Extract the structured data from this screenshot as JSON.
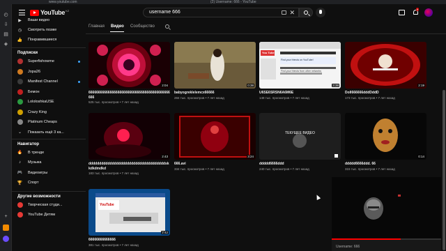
{
  "browser": {
    "address": "www.youtube.com",
    "window_title": "(2) Username: 666 - YouTube"
  },
  "topbar": {
    "logo_text": "YouTube",
    "logo_country": "KZ",
    "search_value": "username 666",
    "notifications_count": "9"
  },
  "sidebar": {
    "top_items": [
      {
        "label": "Ваши видео",
        "icon": "play-icon"
      },
      {
        "label": "Смотреть позже",
        "icon": "clock-icon"
      },
      {
        "label": "Понравившиеся",
        "icon": "thumbs-up-icon"
      }
    ],
    "subscriptions_heading": "Подписки",
    "subscriptions": [
      {
        "label": "Superfishowme",
        "color": "#b03030",
        "live": true
      },
      {
        "label": "Jopa26",
        "color": "#d07a20",
        "live": false
      },
      {
        "label": "Manifest Channel",
        "color": "#3a3a3a",
        "live": true
      },
      {
        "label": "Бемон",
        "color": "#c02020",
        "live": false
      },
      {
        "label": "LololoshkaUSE",
        "color": "#2a9a40",
        "live": false
      },
      {
        "label": "Crazy King",
        "color": "#d0a000",
        "live": false
      },
      {
        "label": "Platinum Cheaps",
        "color": "#888888",
        "live": false
      }
    ],
    "show_more": "Показать ещё 3 ка...",
    "navigator_heading": "Навигатор",
    "navigator": [
      {
        "label": "В тренде",
        "icon": "fire-icon"
      },
      {
        "label": "Музыка",
        "icon": "music-icon"
      },
      {
        "label": "Видеоигры",
        "icon": "gamepad-icon"
      },
      {
        "label": "Спорт",
        "icon": "trophy-icon"
      }
    ],
    "more_heading": "Другие возможности",
    "more": [
      {
        "label": "Творческая студи...",
        "color": "#e53935"
      },
      {
        "label": "YouTube Детям",
        "color": "#e53935"
      }
    ]
  },
  "tabs": [
    "Главная",
    "Видео",
    "Сообщество"
  ],
  "active_tab": "Видео",
  "videos": [
    {
      "title": "666666666666666666666666666666666666666666666",
      "duration": "2:04",
      "views": "525 тыс. просмотров",
      "age": "7 лет назад",
      "theme": "kaleido"
    },
    {
      "title": "babyogreklelemcx66666",
      "duration": "0:38",
      "views": "284 тыс. просмотров",
      "age": "7 лет назад",
      "theme": "woman"
    },
    {
      "title": "U6SE6SRSN6A6M6E",
      "duration": "3:38",
      "views": "148 тыс. просмотров",
      "age": "7 лет назад",
      "theme": "webpage"
    },
    {
      "title": "Doll666666dddDddD",
      "duration": "2:19",
      "views": "173 тыс. просмотров",
      "age": "7 лет назад",
      "theme": "doll"
    },
    {
      "title": "ddddddddddddddddddddddddddddddddddddskkdkdmdkd",
      "duration": "2:43",
      "views": "183 тыс. просмотров",
      "age": "7 лет назад",
      "theme": "darkred"
    },
    {
      "title": "666.avi",
      "duration": "3:24",
      "views": "334 тыс. просмотров",
      "age": "7 лет назад",
      "theme": "redfig"
    },
    {
      "title": "ddddd6666ddd",
      "duration": "",
      "views": "240 тыс. просмотров",
      "age": "7 лет назад",
      "theme": "current"
    },
    {
      "title": "ddddd6666ddd. 66",
      "duration": "0:14",
      "views": "315 тыс. просмотров",
      "age": "7 лет назад",
      "theme": "mask"
    },
    {
      "title": "66666666666666",
      "duration": "2:42",
      "views": "381 тыс. просмотров",
      "age": "7 лет назад",
      "theme": "screen"
    }
  ],
  "current_video_overlay": "ТЕКУЩЕЕ ВИДЕО",
  "thumb_webpage": {
    "header": "You Tube",
    "line1": "Find your friends on YouTube!",
    "line2": "Find your friends from other networks"
  },
  "thumb_screen_logo": "YouTube",
  "miniplayer": {
    "title": "Username: 666",
    "progress": 0.63
  }
}
